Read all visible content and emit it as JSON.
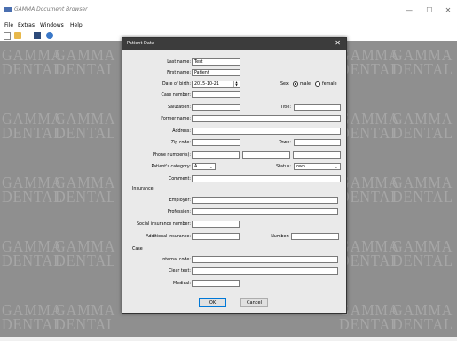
{
  "app": {
    "title": "GAMMA Document Browser",
    "controls": {
      "minimize": "—",
      "maximize": "☐",
      "close": "✕"
    }
  },
  "menu": [
    {
      "label": "File"
    },
    {
      "label": "Extras"
    },
    {
      "label": "Windows"
    },
    {
      "label": "Help"
    }
  ],
  "toolbar": [
    "new-document-icon",
    "open-folder-icon",
    "save-icon",
    "globe-icon"
  ],
  "watermark": {
    "line1": "GAMMA",
    "line2": "DENTAL"
  },
  "dialog": {
    "title": "Patient Data",
    "close": "✕",
    "fields": {
      "last_name": {
        "label": "Last name:",
        "value": "Test"
      },
      "first_name": {
        "label": "First name:",
        "value": "Patient"
      },
      "dob": {
        "label": "Date of birth:",
        "value": "2015-10-21"
      },
      "sex": {
        "label": "Sex:",
        "options": [
          "male",
          "female"
        ],
        "selected": "male"
      },
      "case_number": {
        "label": "Case number:",
        "value": ""
      },
      "salutation": {
        "label": "Salutation:",
        "value": ""
      },
      "title": {
        "label": "Title:",
        "value": ""
      },
      "former_name": {
        "label": "Former name:",
        "value": ""
      },
      "address": {
        "label": "Address:",
        "value": ""
      },
      "zip": {
        "label": "Zip code:",
        "value": ""
      },
      "town": {
        "label": "Town:",
        "value": ""
      },
      "phone": {
        "label": "Phone number(s):",
        "values": [
          "",
          "",
          ""
        ]
      },
      "category": {
        "label": "Patient's category:",
        "value": "A"
      },
      "status": {
        "label": "Status:",
        "value": "own"
      },
      "comment": {
        "label": "Comment:",
        "value": ""
      }
    },
    "insurance": {
      "section": "Insurance",
      "employer": {
        "label": "Employer:",
        "value": ""
      },
      "profession": {
        "label": "Profession:",
        "value": ""
      },
      "social_number": {
        "label": "Social insurance number:",
        "value": ""
      },
      "additional": {
        "label": "Additional insurance:",
        "value": ""
      },
      "number": {
        "label": "Number:",
        "value": ""
      }
    },
    "case": {
      "section": "Case",
      "internal_code": {
        "label": "Internal code:",
        "value": ""
      },
      "clear_text": {
        "label": "Clear text:",
        "value": ""
      },
      "medical": {
        "label": "Medical:",
        "value": ""
      }
    },
    "buttons": {
      "ok": "OK",
      "cancel": "Cancel"
    }
  }
}
